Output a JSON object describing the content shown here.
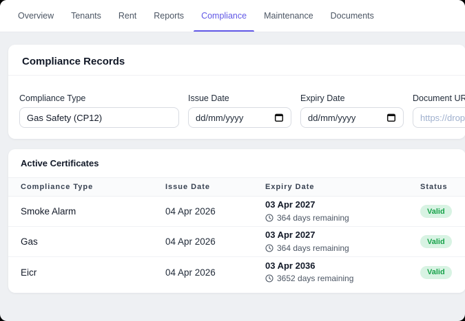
{
  "tabs": [
    {
      "label": "Overview",
      "active": false
    },
    {
      "label": "Tenants",
      "active": false
    },
    {
      "label": "Rent",
      "active": false
    },
    {
      "label": "Reports",
      "active": false
    },
    {
      "label": "Compliance",
      "active": true
    },
    {
      "label": "Maintenance",
      "active": false
    },
    {
      "label": "Documents",
      "active": false
    }
  ],
  "compliance_form": {
    "title": "Compliance Records",
    "compliance_type": {
      "label": "Compliance Type",
      "value": "Gas Safety (CP12)"
    },
    "issue_date": {
      "label": "Issue Date",
      "value": "dd/mm/yyyy"
    },
    "expiry_date": {
      "label": "Expiry Date",
      "value": "dd/mm/yyyy"
    },
    "document_url": {
      "label": "Document URL",
      "placeholder": "https://dropb"
    }
  },
  "certificates": {
    "title": "Active Certificates",
    "headers": [
      "Compliance Type",
      "Issue Date",
      "Expiry Date",
      "Status"
    ],
    "rows": [
      {
        "compliance_type": "Smoke Alarm",
        "issue_date": "04 Apr 2026",
        "expiry_date": "03 Apr 2027",
        "days_remaining": "364 days remaining",
        "status": "Valid"
      },
      {
        "compliance_type": "Gas",
        "issue_date": "04 Apr 2026",
        "expiry_date": "03 Apr 2027",
        "days_remaining": "364 days remaining",
        "status": "Valid"
      },
      {
        "compliance_type": "Eicr",
        "issue_date": "04 Apr 2026",
        "expiry_date": "03 Apr 2036",
        "days_remaining": "3652 days remaining",
        "status": "Valid"
      }
    ]
  },
  "icons": {
    "date_picker": "calendar-icon",
    "days_remaining": "clock-icon"
  },
  "colors": {
    "accent": "#6158e6",
    "valid_badge_bg": "#d8f3e3",
    "valid_badge_text": "#17a24a",
    "page_bg": "#eef0f3"
  }
}
